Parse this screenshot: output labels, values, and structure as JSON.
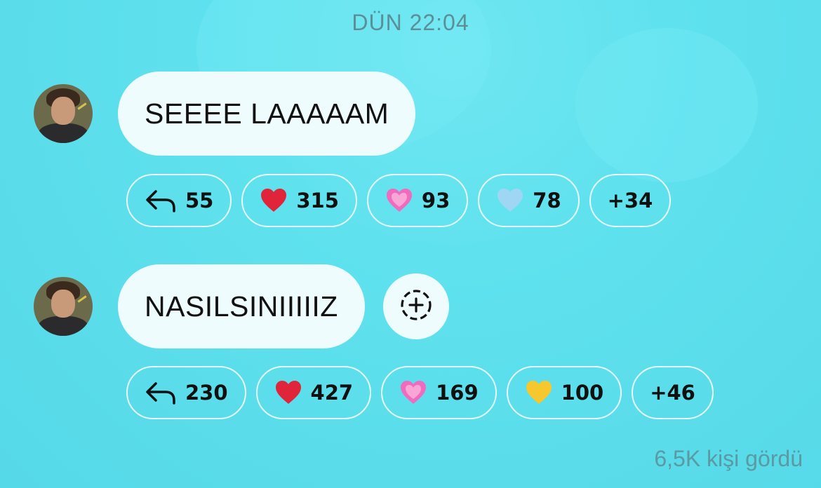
{
  "timestamp": "DÜN 22:04",
  "messages": [
    {
      "text": "SEEEE LAAAAAM",
      "reactions": [
        {
          "icon": "reply-arrow-icon",
          "count": "55"
        },
        {
          "icon": "red-heart-icon",
          "color": "#e0253a",
          "count": "315"
        },
        {
          "icon": "pink-heart-icon",
          "color": "#f06bbd",
          "count": "93"
        },
        {
          "icon": "light-blue-heart-icon",
          "color": "#9fd6f4",
          "count": "78"
        },
        {
          "more": "+34"
        }
      ]
    },
    {
      "text": "NASILSINIIIIIZ",
      "reactions": [
        {
          "icon": "reply-arrow-icon",
          "count": "230"
        },
        {
          "icon": "red-heart-icon",
          "color": "#e0253a",
          "count": "427"
        },
        {
          "icon": "pink-heart-icon",
          "color": "#f06bbd",
          "count": "169"
        },
        {
          "icon": "yellow-heart-icon",
          "color": "#f7c72e",
          "count": "100"
        },
        {
          "more": "+46"
        }
      ]
    }
  ],
  "seen_text": "6,5K kişi gördü"
}
